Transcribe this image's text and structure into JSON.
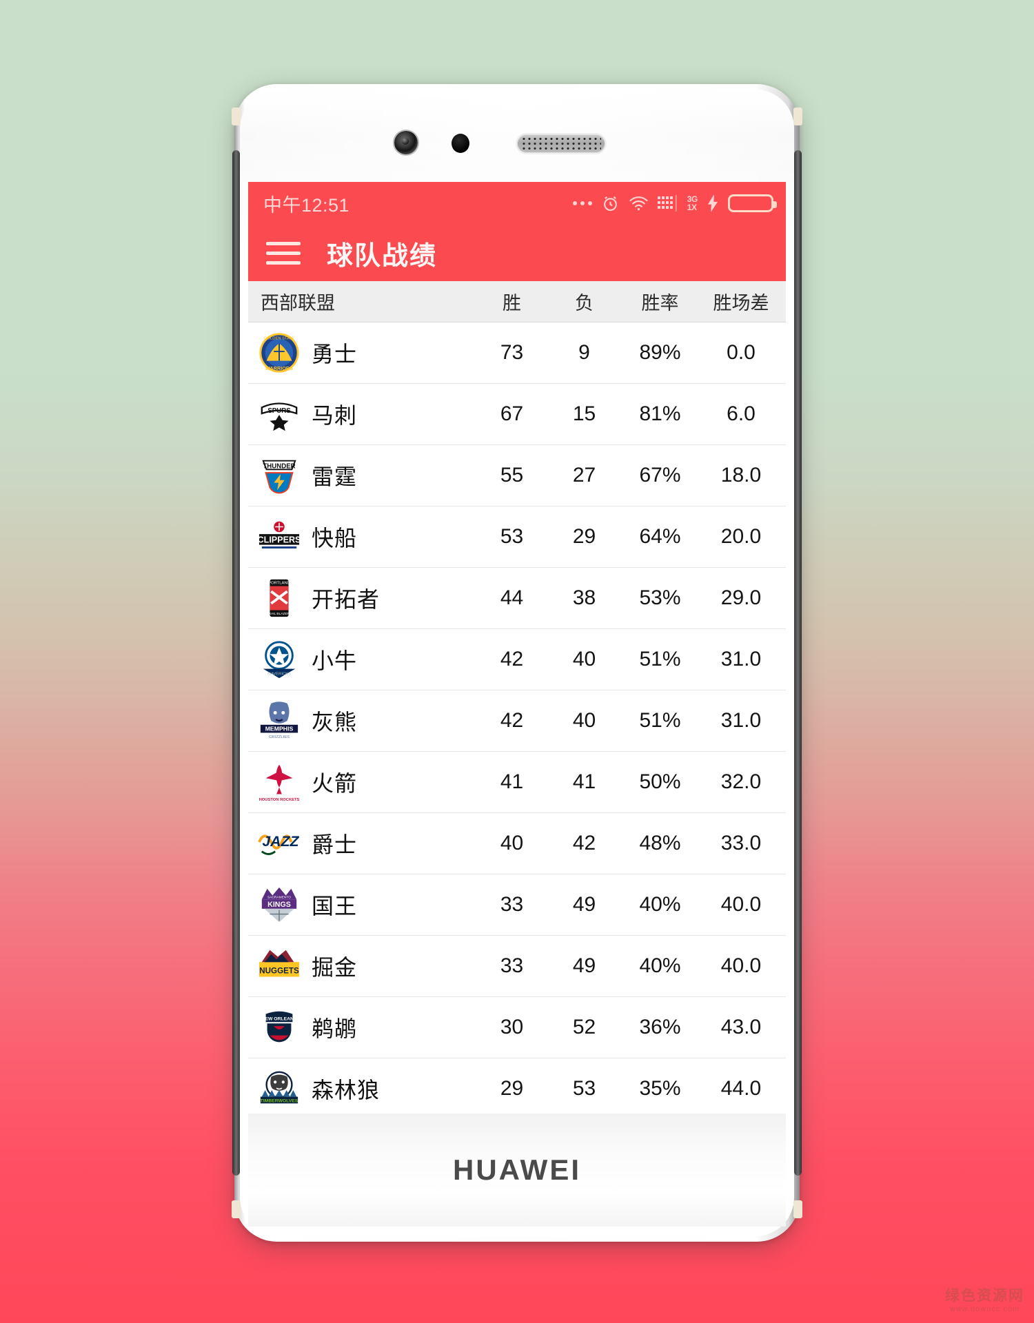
{
  "background": {
    "top_color": "#c9dfc9",
    "bottom_color": "#ff4759"
  },
  "device": {
    "brand": "HUAWEI"
  },
  "status_bar": {
    "time": "中午12:51",
    "icons": [
      "more-dots-icon",
      "alarm-clock-icon",
      "wifi-icon",
      "signal-bars-icon",
      "battery-icon"
    ],
    "network_top": "3G",
    "network_bottom": "1X",
    "battery_level": "100",
    "charging": true,
    "accent_color": "#fb4b50"
  },
  "app_bar": {
    "menu_icon": "hamburger-menu-icon",
    "title": "球队战绩"
  },
  "table": {
    "headers": {
      "team": "西部联盟",
      "wins": "胜",
      "losses": "负",
      "pct": "胜率",
      "gb": "胜场差"
    },
    "rows": [
      {
        "team": "勇士",
        "logo": "warriors-logo",
        "wins": "73",
        "losses": "9",
        "pct": "89%",
        "gb": "0.0"
      },
      {
        "team": "马刺",
        "logo": "spurs-logo",
        "wins": "67",
        "losses": "15",
        "pct": "81%",
        "gb": "6.0"
      },
      {
        "team": "雷霆",
        "logo": "thunder-logo",
        "wins": "55",
        "losses": "27",
        "pct": "67%",
        "gb": "18.0"
      },
      {
        "team": "快船",
        "logo": "clippers-logo",
        "wins": "53",
        "losses": "29",
        "pct": "64%",
        "gb": "20.0"
      },
      {
        "team": "开拓者",
        "logo": "blazers-logo",
        "wins": "44",
        "losses": "38",
        "pct": "53%",
        "gb": "29.0"
      },
      {
        "team": "小牛",
        "logo": "mavericks-logo",
        "wins": "42",
        "losses": "40",
        "pct": "51%",
        "gb": "31.0"
      },
      {
        "team": "灰熊",
        "logo": "grizzlies-logo",
        "wins": "42",
        "losses": "40",
        "pct": "51%",
        "gb": "31.0"
      },
      {
        "team": "火箭",
        "logo": "rockets-logo",
        "wins": "41",
        "losses": "41",
        "pct": "50%",
        "gb": "32.0"
      },
      {
        "team": "爵士",
        "logo": "jazz-logo",
        "wins": "40",
        "losses": "42",
        "pct": "48%",
        "gb": "33.0"
      },
      {
        "team": "国王",
        "logo": "kings-logo",
        "wins": "33",
        "losses": "49",
        "pct": "40%",
        "gb": "40.0"
      },
      {
        "team": "掘金",
        "logo": "nuggets-logo",
        "wins": "33",
        "losses": "49",
        "pct": "40%",
        "gb": "40.0"
      },
      {
        "team": "鹈鹕",
        "logo": "pelicans-logo",
        "wins": "30",
        "losses": "52",
        "pct": "36%",
        "gb": "43.0"
      },
      {
        "team": "森林狼",
        "logo": "timberwolves-logo",
        "wins": "29",
        "losses": "53",
        "pct": "35%",
        "gb": "44.0"
      }
    ]
  },
  "watermark": {
    "text": "绿色资源网",
    "subtext": "www.downcc.com"
  }
}
